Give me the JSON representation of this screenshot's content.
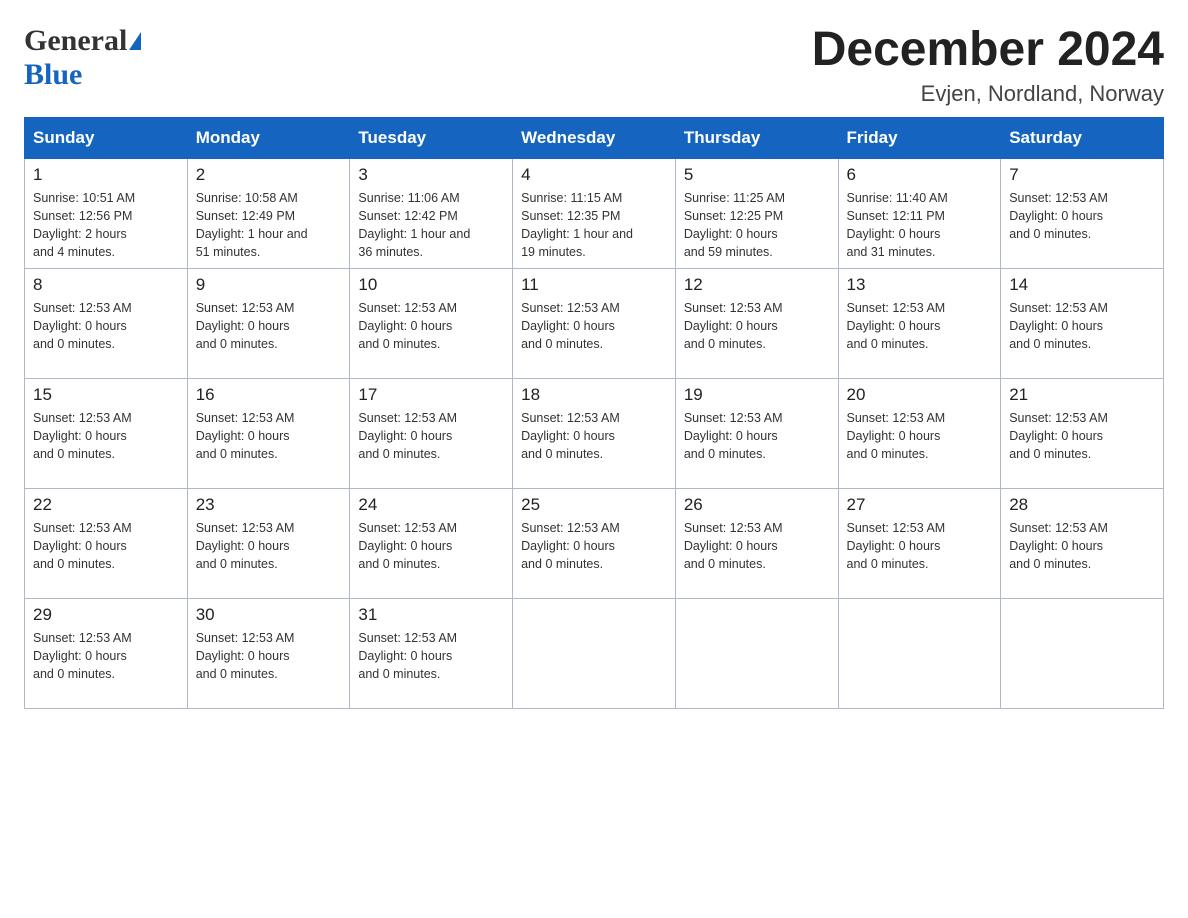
{
  "header": {
    "logo_general": "General",
    "logo_blue": "Blue",
    "month_title": "December 2024",
    "location": "Evjen, Nordland, Norway"
  },
  "calendar": {
    "days_of_week": [
      "Sunday",
      "Monday",
      "Tuesday",
      "Wednesday",
      "Thursday",
      "Friday",
      "Saturday"
    ],
    "weeks": [
      [
        {
          "day": "1",
          "info": "Sunrise: 10:51 AM\nSunset: 12:56 PM\nDaylight: 2 hours\nand 4 minutes."
        },
        {
          "day": "2",
          "info": "Sunrise: 10:58 AM\nSunset: 12:49 PM\nDaylight: 1 hour and\n51 minutes."
        },
        {
          "day": "3",
          "info": "Sunrise: 11:06 AM\nSunset: 12:42 PM\nDaylight: 1 hour and\n36 minutes."
        },
        {
          "day": "4",
          "info": "Sunrise: 11:15 AM\nSunset: 12:35 PM\nDaylight: 1 hour and\n19 minutes."
        },
        {
          "day": "5",
          "info": "Sunrise: 11:25 AM\nSunset: 12:25 PM\nDaylight: 0 hours\nand 59 minutes."
        },
        {
          "day": "6",
          "info": "Sunrise: 11:40 AM\nSunset: 12:11 PM\nDaylight: 0 hours\nand 31 minutes."
        },
        {
          "day": "7",
          "info": "Sunset: 12:53 AM\nDaylight: 0 hours\nand 0 minutes."
        }
      ],
      [
        {
          "day": "8",
          "info": "Sunset: 12:53 AM\nDaylight: 0 hours\nand 0 minutes."
        },
        {
          "day": "9",
          "info": "Sunset: 12:53 AM\nDaylight: 0 hours\nand 0 minutes."
        },
        {
          "day": "10",
          "info": "Sunset: 12:53 AM\nDaylight: 0 hours\nand 0 minutes."
        },
        {
          "day": "11",
          "info": "Sunset: 12:53 AM\nDaylight: 0 hours\nand 0 minutes."
        },
        {
          "day": "12",
          "info": "Sunset: 12:53 AM\nDaylight: 0 hours\nand 0 minutes."
        },
        {
          "day": "13",
          "info": "Sunset: 12:53 AM\nDaylight: 0 hours\nand 0 minutes."
        },
        {
          "day": "14",
          "info": "Sunset: 12:53 AM\nDaylight: 0 hours\nand 0 minutes."
        }
      ],
      [
        {
          "day": "15",
          "info": "Sunset: 12:53 AM\nDaylight: 0 hours\nand 0 minutes."
        },
        {
          "day": "16",
          "info": "Sunset: 12:53 AM\nDaylight: 0 hours\nand 0 minutes."
        },
        {
          "day": "17",
          "info": "Sunset: 12:53 AM\nDaylight: 0 hours\nand 0 minutes."
        },
        {
          "day": "18",
          "info": "Sunset: 12:53 AM\nDaylight: 0 hours\nand 0 minutes."
        },
        {
          "day": "19",
          "info": "Sunset: 12:53 AM\nDaylight: 0 hours\nand 0 minutes."
        },
        {
          "day": "20",
          "info": "Sunset: 12:53 AM\nDaylight: 0 hours\nand 0 minutes."
        },
        {
          "day": "21",
          "info": "Sunset: 12:53 AM\nDaylight: 0 hours\nand 0 minutes."
        }
      ],
      [
        {
          "day": "22",
          "info": "Sunset: 12:53 AM\nDaylight: 0 hours\nand 0 minutes."
        },
        {
          "day": "23",
          "info": "Sunset: 12:53 AM\nDaylight: 0 hours\nand 0 minutes."
        },
        {
          "day": "24",
          "info": "Sunset: 12:53 AM\nDaylight: 0 hours\nand 0 minutes."
        },
        {
          "day": "25",
          "info": "Sunset: 12:53 AM\nDaylight: 0 hours\nand 0 minutes."
        },
        {
          "day": "26",
          "info": "Sunset: 12:53 AM\nDaylight: 0 hours\nand 0 minutes."
        },
        {
          "day": "27",
          "info": "Sunset: 12:53 AM\nDaylight: 0 hours\nand 0 minutes."
        },
        {
          "day": "28",
          "info": "Sunset: 12:53 AM\nDaylight: 0 hours\nand 0 minutes."
        }
      ],
      [
        {
          "day": "29",
          "info": "Sunset: 12:53 AM\nDaylight: 0 hours\nand 0 minutes."
        },
        {
          "day": "30",
          "info": "Sunset: 12:53 AM\nDaylight: 0 hours\nand 0 minutes."
        },
        {
          "day": "31",
          "info": "Sunset: 12:53 AM\nDaylight: 0 hours\nand 0 minutes."
        },
        {
          "day": "",
          "info": ""
        },
        {
          "day": "",
          "info": ""
        },
        {
          "day": "",
          "info": ""
        },
        {
          "day": "",
          "info": ""
        }
      ]
    ]
  }
}
